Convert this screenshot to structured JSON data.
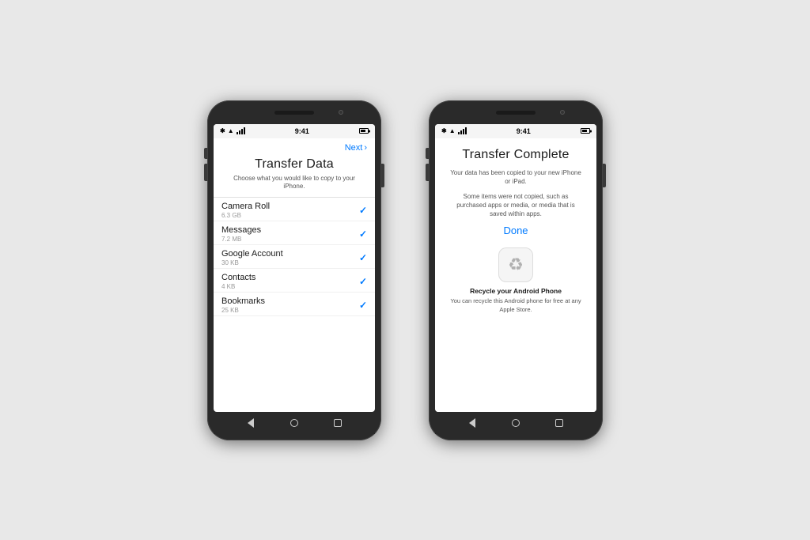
{
  "background_color": "#e8e8e8",
  "phone_left": {
    "status_bar": {
      "bluetooth": "✱",
      "wifi": "▲",
      "signal": "▲",
      "time": "9:41"
    },
    "screen": {
      "next_label": "Next",
      "next_chevron": "›",
      "title": "Transfer Data",
      "subtitle": "Choose what you would like to copy to your iPhone.",
      "items": [
        {
          "name": "Camera Roll",
          "size": "6.3 GB",
          "checked": true
        },
        {
          "name": "Messages",
          "size": "7.2 MB",
          "checked": true
        },
        {
          "name": "Google Account",
          "size": "30 KB",
          "checked": true
        },
        {
          "name": "Contacts",
          "size": "4 KB",
          "checked": true
        },
        {
          "name": "Bookmarks",
          "size": "25 KB",
          "checked": true
        }
      ]
    },
    "nav": {
      "back": "back",
      "home": "home",
      "recents": "recents"
    }
  },
  "phone_right": {
    "status_bar": {
      "bluetooth": "✱",
      "wifi": "▲",
      "signal": "▲",
      "time": "9:41"
    },
    "screen": {
      "title": "Transfer Complete",
      "text1": "Your data has been copied to your new iPhone or iPad.",
      "text2": "Some items were not copied, such as purchased apps or media, or media that is saved within apps.",
      "done_label": "Done",
      "recycle_icon": "♻",
      "recycle_title": "Recycle your Android Phone",
      "recycle_text": "You can recycle this Android phone for free at any Apple Store."
    },
    "nav": {
      "back": "back",
      "home": "home",
      "recents": "recents"
    }
  }
}
